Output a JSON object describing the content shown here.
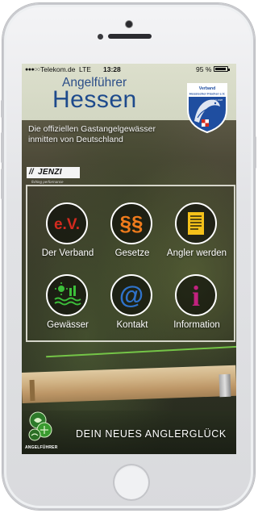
{
  "status_bar": {
    "signal": "●●●○○",
    "carrier": "Telekom.de",
    "network": "LTE",
    "time": "13:28",
    "battery": "95 %"
  },
  "header": {
    "app_subtitle": "Angelführer",
    "app_title": "Hessen",
    "crest": {
      "line1": "Verband",
      "line2": "Hessischer Fischer e.V.",
      "since": "seit 1928"
    }
  },
  "tagline": {
    "line1": "Die offiziellen Gastangelgewässer",
    "line2": "inmitten von Deutschland"
  },
  "sponsor": {
    "name": "JENZI",
    "slogan": "fishing performance"
  },
  "menu": [
    {
      "id": "verband",
      "label": "Der Verband",
      "icon": "ev-icon",
      "glyph": "e.V.",
      "color": "#d42a1f"
    },
    {
      "id": "gesetze",
      "label": "Gesetze",
      "icon": "paragraph-icon",
      "glyph": "§§",
      "color": "#ef7b1c"
    },
    {
      "id": "angler",
      "label": "Angler werden",
      "icon": "document-icon",
      "glyph": "",
      "color": "#f4c11a"
    },
    {
      "id": "gewaesser",
      "label": "Gewässer",
      "icon": "water-icon",
      "glyph": "",
      "color": "#3cbf3a"
    },
    {
      "id": "kontakt",
      "label": "Kontakt",
      "icon": "at-icon",
      "glyph": "@",
      "color": "#2f72c9"
    },
    {
      "id": "information",
      "label": "Information",
      "icon": "info-icon",
      "glyph": "i",
      "color": "#c2227f"
    }
  ],
  "footer": {
    "logo_label": "ANGELFÜHRER",
    "slogan": "DEIN NEUES ANGLERGLÜCK"
  },
  "colors": {
    "header_bg": "#d6d9c6",
    "title_blue": "#1e4a8c",
    "crest_blue": "#1f4ea0"
  }
}
